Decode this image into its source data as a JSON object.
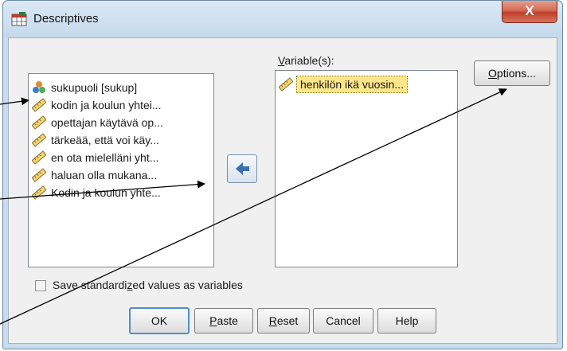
{
  "window": {
    "title": "Descriptives",
    "close_label": "X"
  },
  "source_list": {
    "items": [
      {
        "label": "sukupuoli [sukup]",
        "icon": "nominal-variable-icon"
      },
      {
        "label": "kodin ja koulun yhtei...",
        "icon": "scale-ruler-icon"
      },
      {
        "label": "opettajan käytävä op...",
        "icon": "scale-ruler-icon"
      },
      {
        "label": "tärkeää, että voi käy...",
        "icon": "scale-ruler-icon"
      },
      {
        "label": "en ota mielelläni yht...",
        "icon": "scale-ruler-icon"
      },
      {
        "label": "haluan olla mukana...",
        "icon": "scale-ruler-icon"
      },
      {
        "label": "Kodin ja koulun yhte...",
        "icon": "scale-ruler-icon"
      }
    ]
  },
  "target": {
    "label_prefix": "V",
    "label_rest": "ariable(s):",
    "items": [
      {
        "label": "henkilön ikä vuosin...",
        "icon": "scale-ruler-icon"
      }
    ]
  },
  "buttons": {
    "options_mnemonic": "O",
    "options_rest": "ptions...",
    "ok": "OK",
    "paste_mnemonic": "P",
    "paste_rest": "aste",
    "reset_mnemonic": "R",
    "reset_rest": "eset",
    "cancel": "Cancel",
    "help": "Help"
  },
  "save_checkbox": {
    "pre": "Save standardi",
    "mnemonic": "z",
    "post": "ed values as variables",
    "checked": false
  },
  "colors": {
    "selected_bg": "#fbe68a",
    "arrow_blue": "#3d6fb0",
    "annotation": "#000000"
  }
}
